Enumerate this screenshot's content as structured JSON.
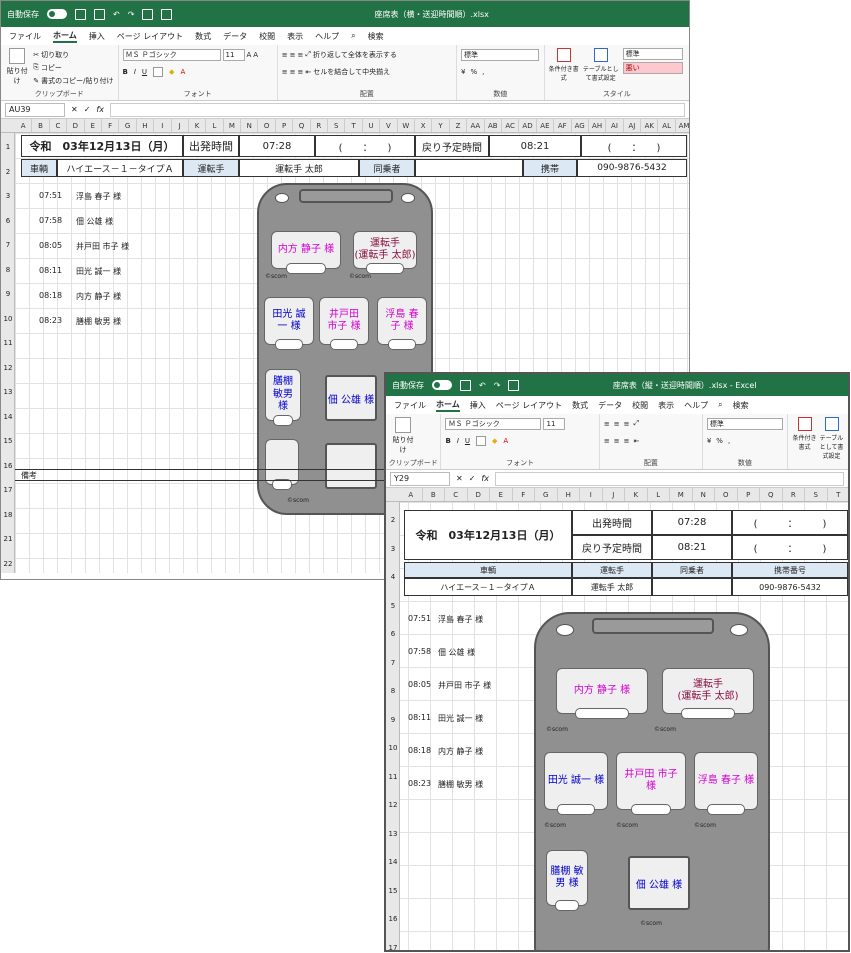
{
  "window1": {
    "autosave": "自動保存",
    "toggle": "オフ",
    "title": "座席表（横・送迎時間順）.xlsx",
    "tabs": [
      "ファイル",
      "ホーム",
      "挿入",
      "ページ レイアウト",
      "数式",
      "データ",
      "校閲",
      "表示",
      "ヘルプ"
    ],
    "search": "検索",
    "clipboard": {
      "paste": "貼り付け",
      "cut": "切り取り",
      "copy": "コピー",
      "format_painter": "書式のコピー/貼り付け",
      "label": "クリップボード"
    },
    "font": {
      "name": "ＭＳ Ｐゴシック",
      "size": "11",
      "label": "フォント"
    },
    "alignment": {
      "wrap": "折り返して全体を表示する",
      "merge": "セルを結合して中央揃え",
      "label": "配置"
    },
    "number": {
      "format": "標準",
      "label": "数値"
    },
    "styles": {
      "cond": "条件付き書式",
      "table": "テーブルとして書式設定",
      "style_standard": "標準",
      "style_bad": "悪い",
      "label": "スタイル"
    },
    "namebox": "AU39",
    "fx": "fx",
    "columns": [
      "A",
      "B",
      "C",
      "D",
      "E",
      "F",
      "G",
      "H",
      "I",
      "J",
      "K",
      "L",
      "M",
      "N",
      "O",
      "P",
      "Q",
      "R",
      "S",
      "T",
      "U",
      "V",
      "W",
      "X",
      "Y",
      "Z",
      "AA",
      "AB",
      "AC",
      "AD",
      "AE",
      "AF",
      "AG",
      "AH",
      "AI",
      "AJ",
      "AK",
      "AL",
      "AM"
    ],
    "rows": [
      "1",
      "2",
      "3",
      "6",
      "7",
      "8",
      "9",
      "10",
      "11",
      "12",
      "13",
      "14",
      "15",
      "16",
      "17",
      "18",
      "21",
      "22"
    ],
    "header": {
      "date": "令和　03年12月13日（月）",
      "depart_label": "出発時間",
      "depart_time": "07:28",
      "depart_paren": "(　　：　　)",
      "return_label": "戻り予定時間",
      "return_time": "08:21",
      "return_paren": "(　　：　　)",
      "vehicle_label": "車輌",
      "vehicle": "ハイエース－１－タイプＡ",
      "driver_label": "運転手",
      "driver": "運転手 太郎",
      "companion_label": "同乗者",
      "companion": "",
      "phone_label": "携帯",
      "phone": "090-9876-5432"
    },
    "stops": [
      {
        "time": "07:51",
        "name": "浮島 春子 様"
      },
      {
        "time": "07:58",
        "name": "佃 公雄 様"
      },
      {
        "time": "08:05",
        "name": "井戸田 市子 様"
      },
      {
        "time": "08:11",
        "name": "田光 誠一 様"
      },
      {
        "time": "08:18",
        "name": "内方 静子 様"
      },
      {
        "time": "08:23",
        "name": "膳棚 敏男 様"
      }
    ],
    "seats": {
      "r1l": "内方 静子 様",
      "r1r": "運転手\n(運転手 太郎)",
      "r2a": "田光 誠\n一 様",
      "r2b": "井戸田\n市子 様",
      "r2c": "浮島 春\n子 様",
      "r3a": "膳棚\n敏男\n様",
      "wc1": "佃 公雄 様"
    },
    "copyright": "©scom",
    "remarks": "備考"
  },
  "window2": {
    "autosave": "自動保存",
    "toggle": "オフ",
    "title": "座席表（縦・送迎時間順）.xlsx - Excel",
    "tabs": [
      "ファイル",
      "ホーム",
      "挿入",
      "ページ レイアウト",
      "数式",
      "データ",
      "校閲",
      "表示",
      "ヘルプ"
    ],
    "search": "検索",
    "clipboard_label": "クリップボード",
    "paste": "貼り付け",
    "font": {
      "name": "ＭＳ Ｐゴシック",
      "size": "11",
      "label": "フォント"
    },
    "alignment_label": "配置",
    "number": {
      "format": "標準",
      "label": "数値"
    },
    "cond": "条件付き書式",
    "table": "テーブルとして書式設定",
    "namebox": "Y29",
    "fx": "fx",
    "columns": [
      "A",
      "B",
      "C",
      "D",
      "E",
      "F",
      "G",
      "H",
      "I",
      "J",
      "K",
      "L",
      "M",
      "N",
      "O",
      "P",
      "Q",
      "R",
      "S",
      "T"
    ],
    "rows": [
      "2",
      "3",
      "4",
      "5",
      "6",
      "7",
      "8",
      "9",
      "10",
      "11",
      "12",
      "13",
      "14",
      "15",
      "16",
      "17"
    ],
    "header": {
      "date": "令和　03年12月13日（月）",
      "depart_label": "出発時間",
      "depart_time": "07:28",
      "depart_paren": "(　　　：　　　)",
      "return_label": "戻り予定時間",
      "return_time": "08:21",
      "return_paren": "(　　　：　　　)",
      "vehicle_label": "車輌",
      "driver_label": "運転手",
      "companion_label": "同乗者",
      "phone_label": "携帯番号",
      "vehicle": "ハイエース－１－タイプＡ",
      "driver": "運転手 太郎",
      "companion": "",
      "phone": "090-9876-5432"
    },
    "stops": [
      {
        "time": "07:51",
        "name": "浮島 春子 様"
      },
      {
        "time": "07:58",
        "name": "佃 公雄 様"
      },
      {
        "time": "08:05",
        "name": "井戸田 市子 様"
      },
      {
        "time": "08:11",
        "name": "田光 誠一 様"
      },
      {
        "time": "08:18",
        "name": "内方 静子 様"
      },
      {
        "time": "08:23",
        "name": "膳棚 敏男 様"
      }
    ],
    "seats": {
      "r1l": "内方 静子 様",
      "r1r": "運転手\n(運転手 太郎)",
      "r2a": "田光 誠一 様",
      "r2b": "井戸田 市子\n様",
      "r2c": "浮島 春子 様",
      "r3a": "膳棚 敏\n男 様",
      "wc1": "佃 公雄 様"
    },
    "copyright": "©scom"
  }
}
